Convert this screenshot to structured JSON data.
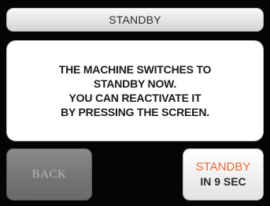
{
  "header": {
    "title": "STANDBY"
  },
  "message": {
    "lines": [
      "THE MACHINE SWITCHES TO",
      "STANDBY NOW.",
      "YOU CAN REACTIVATE IT",
      "BY PRESSING THE SCREEN."
    ]
  },
  "buttons": {
    "back_label": "BACK",
    "standby_label": "STANDBY",
    "countdown_label": "IN 9 SEC"
  },
  "colors": {
    "background": "#050505",
    "standby_accent": "#e86a3a",
    "back_button": "#767676",
    "panel": "#ffffff"
  }
}
